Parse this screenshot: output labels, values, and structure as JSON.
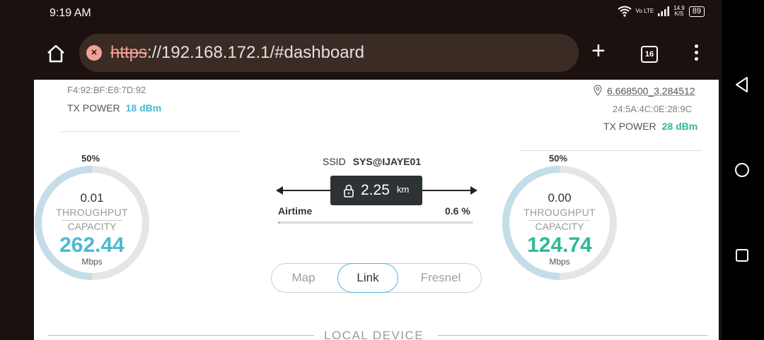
{
  "status_bar": {
    "time": "9:19 AM",
    "volte": "Vo LTE",
    "net_speed": "14.9",
    "net_speed_unit": "K/S",
    "battery": "89"
  },
  "browser": {
    "url_scheme": "https",
    "url_rest": "://192.168.172.1/#dashboard",
    "tab_count": "16"
  },
  "left_device": {
    "mac": "F4:92:BF:E8:7D:92",
    "tx_power_label": "TX POWER",
    "tx_power_value": "18 dBm",
    "gauge_percent": "50%",
    "throughput": "0.01",
    "throughput_label": "THROUGHPUT",
    "capacity_label": "CAPACITY",
    "capacity": "262.44",
    "unit": "Mbps",
    "accent": "#4bbad3",
    "gauge_fraction": 0.5
  },
  "right_device": {
    "coordinates": "6.668500_3.284512",
    "mac": "24:5A:4C:0E:28:9C",
    "tx_power_label": "TX POWER",
    "tx_power_value": "28 dBm",
    "gauge_percent": "50%",
    "throughput": "0.00",
    "throughput_label": "THROUGHPUT",
    "capacity_label": "CAPACITY",
    "capacity": "124.74",
    "unit": "Mbps",
    "accent": "#2fb99a",
    "gauge_fraction": 0.5
  },
  "link": {
    "ssid_label": "SSID",
    "ssid": "SYS@IJAYE01",
    "distance": "2.25",
    "distance_unit": "km",
    "airtime_label": "Airtime",
    "airtime_value": "0.6 %",
    "airtime_fraction": 0.006
  },
  "view_tabs": [
    {
      "label": "Map"
    },
    {
      "label": "Link"
    },
    {
      "label": "Fresnel"
    }
  ],
  "section_title": "LOCAL DEVICE",
  "icons": [
    "home-icon",
    "insecure-icon",
    "new-tab-icon",
    "tab-switcher-icon",
    "overflow-menu-icon",
    "nav-back-icon",
    "nav-home-icon",
    "nav-recents-icon",
    "location-pin-icon",
    "lock-icon",
    "wifi-icon",
    "signal-icon"
  ]
}
